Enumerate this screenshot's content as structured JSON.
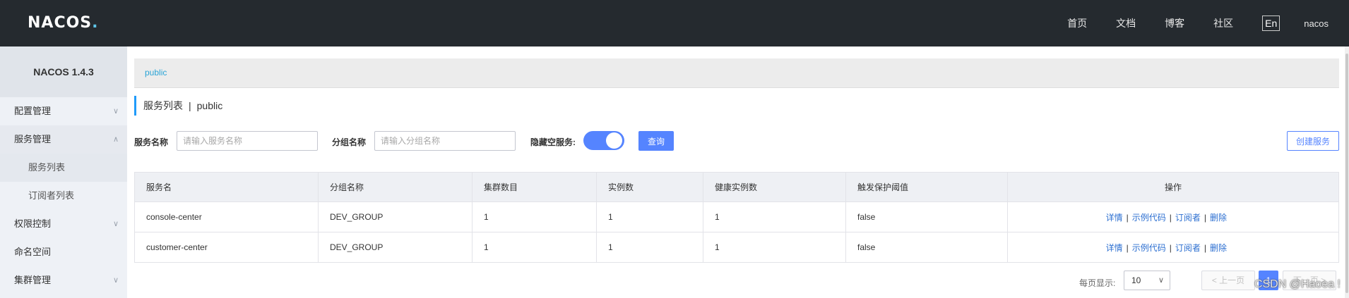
{
  "topbar": {
    "logo_main": "NACOS",
    "logo_dot": ".",
    "nav": [
      "首页",
      "文档",
      "博客",
      "社区"
    ],
    "lang": "En",
    "user": "nacos"
  },
  "sidebar": {
    "version": "NACOS 1.4.3",
    "items": [
      {
        "label": "配置管理",
        "chevron": "∨"
      },
      {
        "label": "服务管理",
        "chevron": "∧"
      },
      {
        "label": "服务列表"
      },
      {
        "label": "订阅者列表"
      },
      {
        "label": "权限控制",
        "chevron": "∨"
      },
      {
        "label": "命名空间"
      },
      {
        "label": "集群管理",
        "chevron": "∨"
      }
    ]
  },
  "main": {
    "namespace": "public",
    "title": "服务列表",
    "title_sep": "|",
    "title_ns": "public",
    "filters": {
      "service_label": "服务名称",
      "service_placeholder": "请输入服务名称",
      "group_label": "分组名称",
      "group_placeholder": "请输入分组名称",
      "hide_empty_label": "隐藏空服务:",
      "hide_empty_on": true,
      "query_label": "查询",
      "create_label": "创建服务"
    },
    "table": {
      "headers": [
        "服务名",
        "分组名称",
        "集群数目",
        "实例数",
        "健康实例数",
        "触发保护阈值",
        "操作"
      ],
      "rows": [
        {
          "name": "console-center",
          "group": "DEV_GROUP",
          "clusters": "1",
          "instances": "1",
          "healthy": "1",
          "threshold": "false"
        },
        {
          "name": "customer-center",
          "group": "DEV_GROUP",
          "clusters": "1",
          "instances": "1",
          "healthy": "1",
          "threshold": "false"
        }
      ],
      "ops": {
        "detail": "详情",
        "sample": "示例代码",
        "subscriber": "订阅者",
        "delete": "删除",
        "sep": "|"
      }
    },
    "pager": {
      "per_page_label": "每页显示:",
      "per_page_value": "10",
      "prev": "< 上一页",
      "current": "1",
      "next": "下一页 >"
    }
  },
  "watermark": "CSDN @Haoea !",
  "colors": {
    "accent": "#5584ff",
    "topbar": "#252a2f",
    "sidebar": "#eef1f6"
  }
}
